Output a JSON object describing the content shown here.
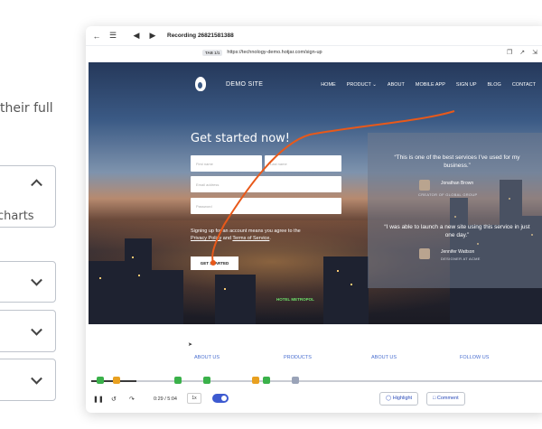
{
  "background_page": {
    "text_fragment": "their full",
    "accordion_open_fragment": "charts"
  },
  "player": {
    "recording_title": "Recording 26821581388",
    "tab_badge": "TAB 1/1",
    "url": "https://technology-demo.hotjar.com/sign-up",
    "site": {
      "brand": "DEMO SITE",
      "nav": [
        "HOME",
        "PRODUCT ⌄",
        "ABOUT",
        "MOBILE APP",
        "SIGN UP",
        "BLOG",
        "CONTACT"
      ],
      "hero_title": "Get started now!",
      "field_placeholders": [
        "First name",
        "Last name",
        "Email address",
        "Password"
      ],
      "terms_prefix": "Signing up for an account means you agree to the",
      "privacy_link": "Privacy Policy",
      "and_text": "and",
      "terms_link": "Terms of Service",
      "cta": "GET STARTED",
      "hotel_sign": "HOTEL METROPOL",
      "testimonials": [
        {
          "quote": "“This is one of the best services I’ve used for my business.”",
          "name": "Jonathan Brown",
          "role": "CREATOR OF GLOBAL GROUP"
        },
        {
          "quote": "“I was able to launch a new site using this service in just one day.”",
          "name": "Jennifer Wattson",
          "role": "DESIGNER AT ACME"
        }
      ],
      "footer_links": [
        "ABOUT US",
        "PRODUCTS",
        "ABOUT US",
        "FOLLOW US"
      ]
    },
    "playback": {
      "time": "0:29 / 5:04",
      "speed": "1x",
      "progress_fraction": 0.1,
      "highlight_label": "Highlight",
      "comment_label": "Comment"
    },
    "colors": {
      "accent": "#3d5ad0",
      "trail": "#e8591a",
      "link": "#4a6fd0"
    }
  }
}
